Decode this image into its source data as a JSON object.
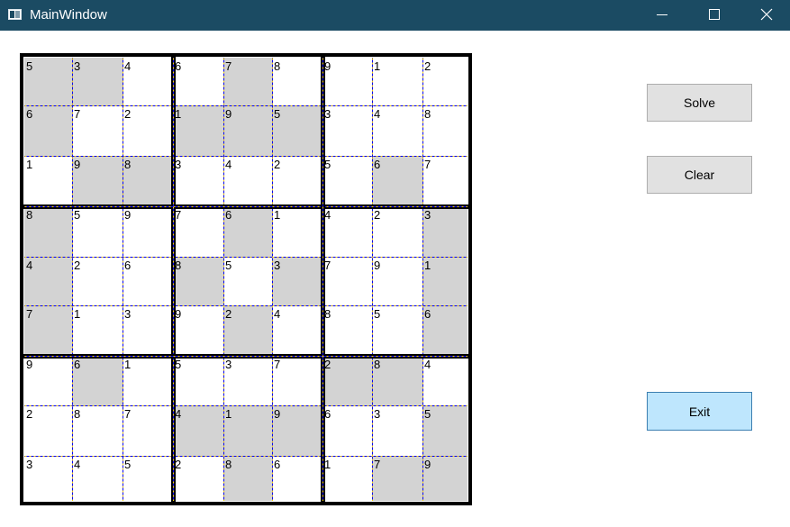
{
  "window": {
    "title": "MainWindow"
  },
  "title_bar": {
    "background": "#1b4b63",
    "controls": [
      "minimize-icon",
      "maximize-icon",
      "close-icon"
    ]
  },
  "board": {
    "values": [
      [
        "5",
        "3",
        "4",
        "6",
        "7",
        "8",
        "9",
        "1",
        "2"
      ],
      [
        "6",
        "7",
        "2",
        "1",
        "9",
        "5",
        "3",
        "4",
        "8"
      ],
      [
        "1",
        "9",
        "8",
        "3",
        "4",
        "2",
        "5",
        "6",
        "7"
      ],
      [
        "8",
        "5",
        "9",
        "7",
        "6",
        "1",
        "4",
        "2",
        "3"
      ],
      [
        "4",
        "2",
        "6",
        "8",
        "5",
        "3",
        "7",
        "9",
        "1"
      ],
      [
        "7",
        "1",
        "3",
        "9",
        "2",
        "4",
        "8",
        "5",
        "6"
      ],
      [
        "9",
        "6",
        "1",
        "5",
        "3",
        "7",
        "2",
        "8",
        "4"
      ],
      [
        "2",
        "8",
        "7",
        "4",
        "1",
        "9",
        "6",
        "3",
        "5"
      ],
      [
        "3",
        "4",
        "5",
        "2",
        "8",
        "6",
        "1",
        "7",
        "9"
      ]
    ],
    "shaded": [
      [
        1,
        1,
        0,
        0,
        1,
        0,
        0,
        0,
        0
      ],
      [
        1,
        0,
        0,
        1,
        1,
        1,
        0,
        0,
        0
      ],
      [
        0,
        1,
        1,
        0,
        0,
        0,
        0,
        1,
        0
      ],
      [
        1,
        0,
        0,
        0,
        1,
        0,
        0,
        0,
        1
      ],
      [
        1,
        0,
        0,
        1,
        0,
        1,
        0,
        0,
        1
      ],
      [
        1,
        0,
        0,
        0,
        1,
        0,
        0,
        0,
        1
      ],
      [
        0,
        1,
        0,
        0,
        0,
        0,
        1,
        1,
        0
      ],
      [
        0,
        0,
        0,
        1,
        1,
        1,
        0,
        0,
        1
      ],
      [
        0,
        0,
        0,
        0,
        1,
        0,
        0,
        1,
        1
      ]
    ],
    "shade_color": "#d3d3d3",
    "grid_colors": [
      "#0000ff",
      "#ffd700"
    ]
  },
  "buttons": {
    "solve_label": "Solve",
    "clear_label": "Clear",
    "exit_label": "Exit"
  }
}
